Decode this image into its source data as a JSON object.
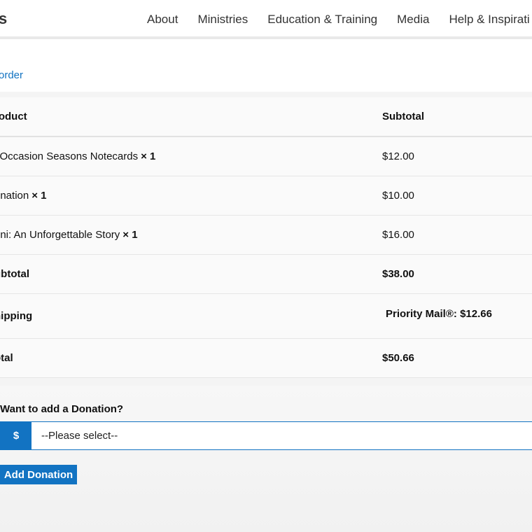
{
  "header": {
    "logo_fragment": "s",
    "nav": [
      "About",
      "Ministries",
      "Education & Training",
      "Media",
      "Help & Inspirati"
    ]
  },
  "order_link": "order",
  "table": {
    "headers": {
      "product": "roduct",
      "subtotal": "Subtotal"
    },
    "items": [
      {
        "name": "l Occasion Seasons Notecards",
        "qty": "× 1",
        "price": "$12.00"
      },
      {
        "name": "onation",
        "qty": "× 1",
        "price": "$10.00"
      },
      {
        "name": "oni: An Unforgettable Story",
        "qty": "× 1",
        "price": "$16.00"
      }
    ],
    "subtotal": {
      "label": "ubtotal",
      "value": "$38.00"
    },
    "shipping": {
      "label": "hipping",
      "value": "Priority Mail®: $12.66"
    },
    "total": {
      "label": "otal",
      "value": "$50.66"
    }
  },
  "donation": {
    "title": "Want to add a Donation?",
    "currency_symbol": "$",
    "select_value": "--Please select--",
    "button_label": "Add Donation"
  },
  "colors": {
    "accent": "#1273c2"
  }
}
